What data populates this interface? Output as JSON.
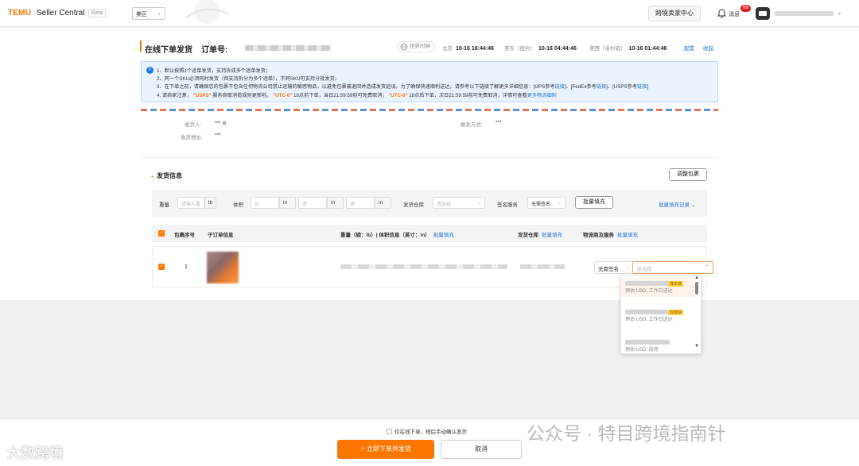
{
  "header": {
    "logo": "TEMU",
    "app_name": "Seller Central",
    "beta": "Beta",
    "region": "美区",
    "cross_border_center": "跨境卖家中心",
    "messages_label": "消息",
    "messages_count": "69"
  },
  "page": {
    "title": "在线下单发货",
    "order_label": "订单号:"
  },
  "world_time": {
    "label": "世界时钟",
    "zones": [
      {
        "name": "北京",
        "time": "10-16 16:44:46"
      },
      {
        "name": "美东（纽约）",
        "time": "10-16 04:44:46"
      },
      {
        "name": "美西（洛杉矶）",
        "time": "10-16 01:44:46"
      }
    ],
    "config": "配置",
    "collapse": "收起"
  },
  "notice": {
    "line1": "1、默认按照1个运单发货，支持拆成多个运单发货；",
    "line2": "2、同一个SKU必须同时发货（但支持拆分为多个运单），不同SKU可支持分批发货。",
    "line3": "3、在下单之前，请确保您的包裹不包含任何物流公司禁止运输的敏感物品，以避免包裹被退回并造成发货延误。为了确保快速顺利送达，请参考以下链接了解更多详细信息：[UPS参考",
    "line3_links": [
      "链接",
      "链接",
      "链接"
    ],
    "line3_mid1": "]、[FedEx参考",
    "line3_mid2": "]、[USPS参考",
    "line3_end": "]",
    "line4_prefix": "4. 请商家注意，",
    "line4_usps": "\"USPS\"",
    "line4_mid1": "服务商取消揽规则更新啦，",
    "line4_utc1": "\"UTC-6\"",
    "line4_mid2": "18点前下单，当日21:59:59前可免费取消；",
    "line4_utc2": "\"UTC-6\"",
    "line4_mid3": "18点后下单，次日21:59:59前可免费取消，详情可查看",
    "line4_link": "更多物流细则"
  },
  "address": {
    "receiver_label": "收货人:",
    "receiver_value": "*** ⊘",
    "contact_label": "联系方式:",
    "contact_value": "***",
    "address_label": "收货地址:",
    "address_value": "***"
  },
  "shipping": {
    "title": "发货信息",
    "adjust_button": "调整包裹",
    "weight_label": "重量",
    "weight_placeholder": "请输入重",
    "weight_unit": "lb",
    "volume_label": "体积",
    "length_placeholder": "长",
    "width_placeholder": "宽",
    "height_placeholder": "高",
    "dim_unit": "in",
    "warehouse_label": "发货仓库",
    "warehouse_placeholder": "请选择",
    "signature_label": "签名服务",
    "signature_value": "无需签名",
    "bulk_fill_button": "批量填充",
    "bulk_history": "批量填充记录",
    "columns": {
      "pkg_no": "包裹序号",
      "sub_order": "子订单信息",
      "weight_dims": "重量（磅：lb）| 体积信息（英寸：in）",
      "warehouse": "发货仓库",
      "logistics": "物流商及服务",
      "bulk_fill": "批量填充"
    },
    "row": {
      "index": "1",
      "signature": "无需签名",
      "service_placeholder": "请选择"
    }
  },
  "dropdown": {
    "items": [
      {
        "tag": "成本低",
        "desc": "预估 USD; 工作日送达"
      },
      {
        "tag": "时效快",
        "desc": "预估 USD; 工作日送达"
      },
      {
        "tag": "",
        "desc": "预估 USD; 自然"
      }
    ]
  },
  "footer": {
    "only_online": "仅在线下单，稍后手动确认发货",
    "submit": "⚡ 立即下单并发货",
    "cancel": "取消"
  },
  "watermark": {
    "left": "大数跨境",
    "right": "公众号 · 特目跨境指南针"
  },
  "colors": {
    "brand": "#fb7701",
    "link": "#2073d4",
    "notice_bg": "#e8f3fe"
  }
}
